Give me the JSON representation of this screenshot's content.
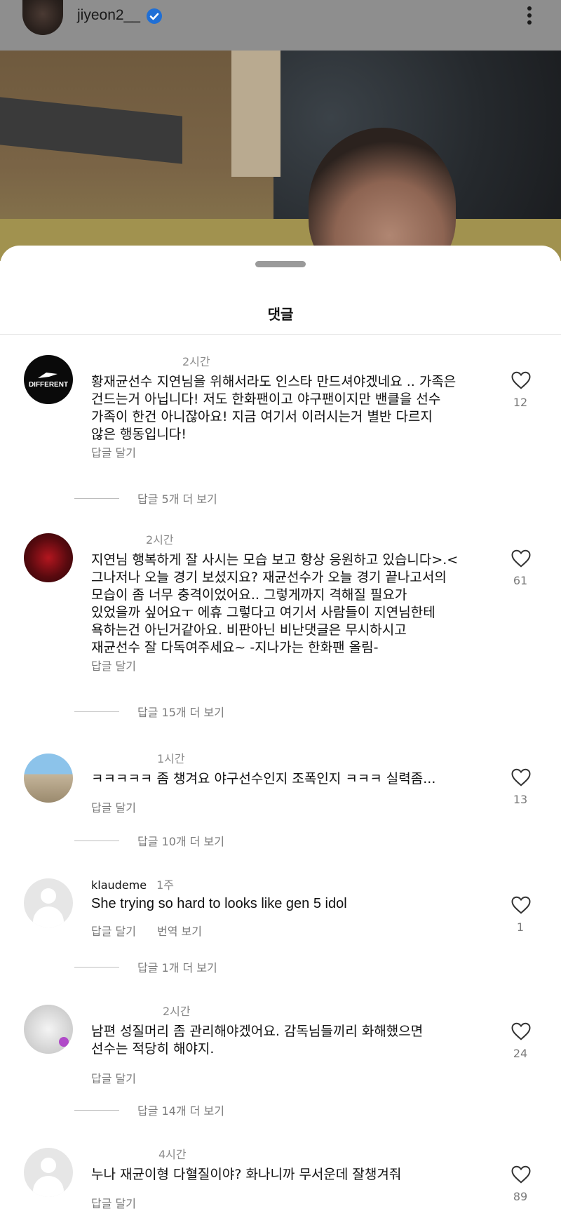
{
  "post": {
    "username": "jiyeon2__",
    "verified_icon": "verified-badge-icon",
    "more_icon": "more-vertical-icon"
  },
  "sheet": {
    "title": "댓글"
  },
  "comments": [
    {
      "username": "",
      "time": "2시간",
      "text": "황재균선수 지연님을 위해서라도 인스타 만드셔야겠네요 .. 가족은\n건드는거 아닙니다! 저도 한화팬이고 야구팬이지만 밴클을 선수\n가족이 한건 아니잖아요! 지금 여기서 이러시는거 별반 다르지\n않은 행동입니다!",
      "reply": "답글 달기",
      "translate": "",
      "likes": "12",
      "more_replies": "답글 5개 더 보기",
      "avatar_text": "DIFFERENT"
    },
    {
      "username": "",
      "time": "2시간",
      "text": "지연님 행복하게 잘 사시는 모습 보고 항상 응원하고 있습니다>.<\n그나저나 오늘 경기 보셨지요? 재균선수가 오늘 경기 끝나고서의\n모습이 좀 너무 충격이었어요.. 그렇게까지 격해질 필요가\n있었을까 싶어요ㅜ 에휴 그렇다고 여기서 사람들이 지연님한테\n욕하는건 아닌거같아요. 비판아닌 비난댓글은 무시하시고\n재균선수 잘 다독여주세요~ -지나가는 한화팬 올림-",
      "reply": "답글 달기",
      "translate": "",
      "likes": "61",
      "more_replies": "답글 15개 더 보기"
    },
    {
      "username": "",
      "time": "1시간",
      "text": "ㅋㅋㅋㅋㅋ 좀 챙겨요 야구선수인지 조폭인지 ㅋㅋㅋ 실력좀...",
      "reply": "답글 달기",
      "translate": "",
      "likes": "13",
      "more_replies": "답글 10개 더 보기"
    },
    {
      "username": "klaudeme",
      "time": "1주",
      "text": "She trying so hard to looks like gen 5 idol",
      "reply": "답글 달기",
      "translate": "번역 보기",
      "likes": "1",
      "more_replies": "답글 1개 더 보기"
    },
    {
      "username": "",
      "time": "2시간",
      "text": "남편 성질머리 좀 관리해야겠어요. 감독님들끼리 화해했으면\n선수는 적당히 해야지.",
      "reply": "답글 달기",
      "translate": "",
      "likes": "24",
      "more_replies": "답글 14개 더 보기"
    },
    {
      "username": "",
      "time": "4시간",
      "text": "누나 재균이형 다혈질이야? 화나니까 무서운데 잘챙겨줘",
      "reply": "답글 달기",
      "translate": "",
      "likes": "89",
      "more_replies": ""
    }
  ],
  "icons": {
    "heart": "heart-outline-icon",
    "default_avatar": "default-avatar-icon"
  }
}
